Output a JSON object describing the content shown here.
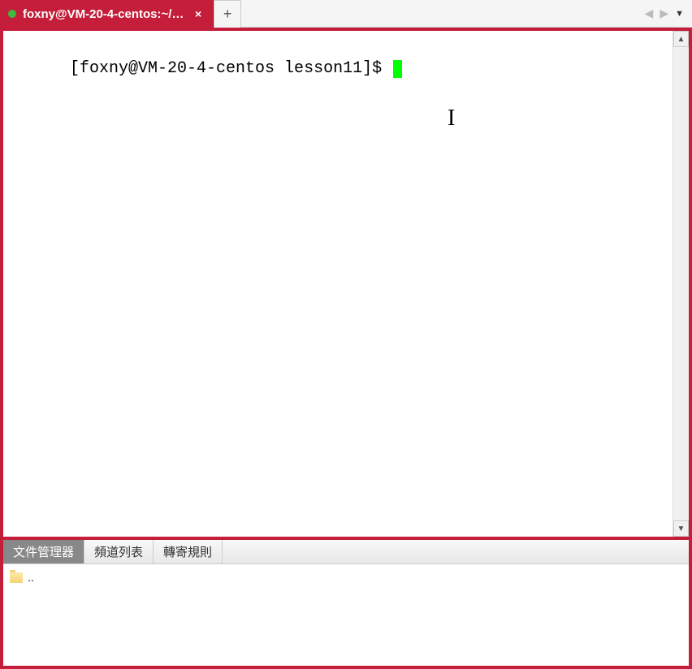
{
  "titlebar": {
    "tab_title": "foxny@VM-20-4-centos:~/l...",
    "close_glyph": "×",
    "newtab_glyph": "+",
    "nav_prev": "◀",
    "nav_next": "▶",
    "menu_glyph": "▼"
  },
  "terminal": {
    "prompt": "[foxny@VM-20-4-centos lesson11]$ "
  },
  "bottom": {
    "tabs": [
      {
        "label": "文件管理器",
        "active": true
      },
      {
        "label": "頻道列表",
        "active": false
      },
      {
        "label": "轉寄規則",
        "active": false
      }
    ],
    "file_item": ".."
  },
  "scrollbar": {
    "up": "▲",
    "down": "▼"
  }
}
